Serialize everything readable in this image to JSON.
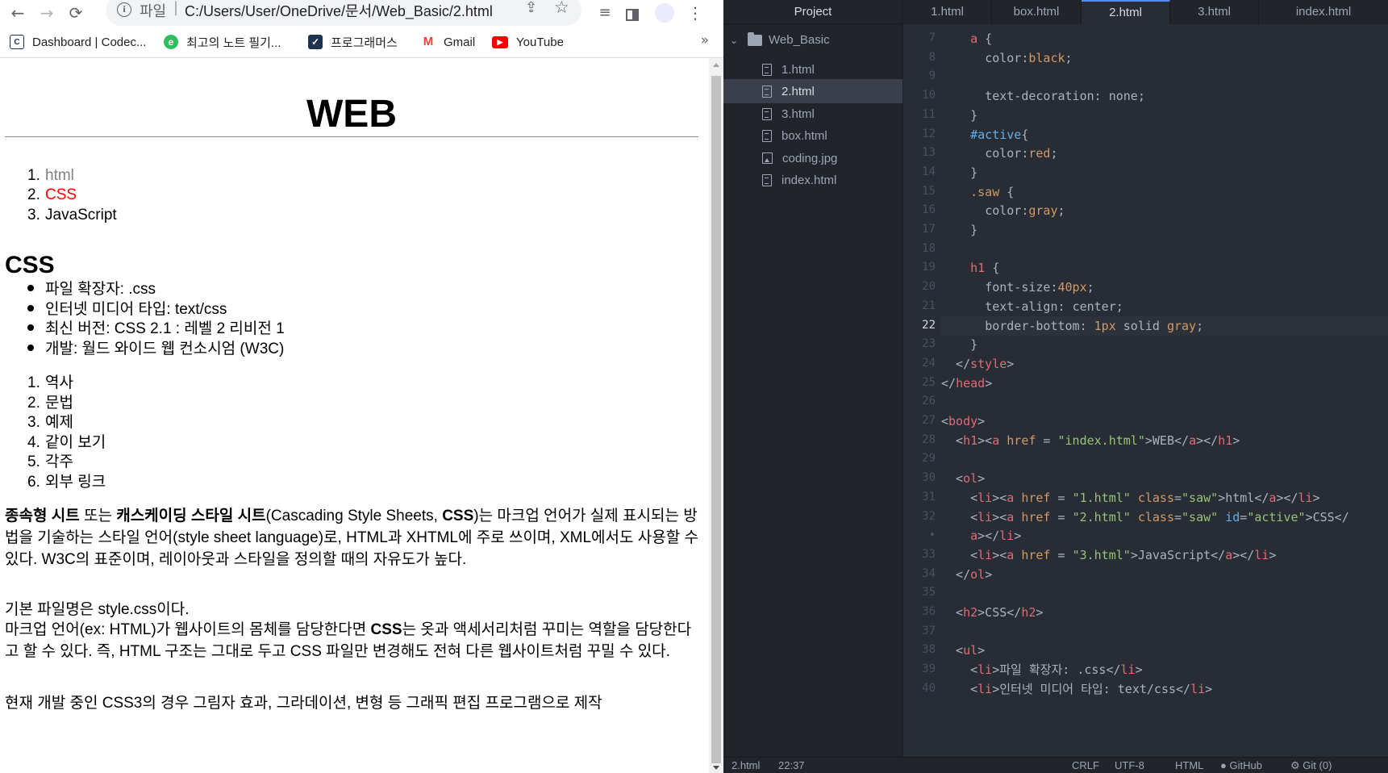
{
  "browser": {
    "nav": {
      "back": "←",
      "forward": "→",
      "reload": "⟳"
    },
    "omnibox": {
      "scheme": "파일",
      "separator": "|",
      "url": "C:/Users/User/OneDrive/문서/Web_Basic/2.html"
    },
    "bookmarks": [
      {
        "icon": "codecademy-icon",
        "label": "Dashboard | Codec...",
        "color": "#1f2d5c"
      },
      {
        "icon": "evernote-icon",
        "label": "최고의 노트 필기...",
        "color": "#2dbe60"
      },
      {
        "icon": "programmers-icon",
        "label": "프로그래머스",
        "color": "#1e3350"
      },
      {
        "icon": "gmail-icon",
        "label": "Gmail",
        "color": "#ea4335"
      },
      {
        "icon": "youtube-icon",
        "label": "YouTube",
        "color": "#ff0000"
      }
    ],
    "bookmarks_more": "»"
  },
  "page": {
    "h1": "WEB",
    "nav_list": [
      {
        "num": "1.",
        "label": "html",
        "color": "#808080"
      },
      {
        "num": "2.",
        "label": "CSS",
        "color": "#ff0000"
      },
      {
        "num": "3.",
        "label": "JavaScript",
        "color": "#000000"
      }
    ],
    "h2": "CSS",
    "facts": [
      "파일 확장자: .css",
      "인터넷 미디어 타입: text/css",
      "최신 버전: CSS 2.1 : 레벨 2 리비전 1",
      "개발: 월드 와이드 웹 컨소시엄 (W3C)"
    ],
    "sections": [
      {
        "num": "1.",
        "label": "역사"
      },
      {
        "num": "2.",
        "label": "문법"
      },
      {
        "num": "3.",
        "label": "예제"
      },
      {
        "num": "4.",
        "label": "같이 보기"
      },
      {
        "num": "5.",
        "label": "각주"
      },
      {
        "num": "6.",
        "label": "외부 링크"
      }
    ],
    "para1": {
      "b1": "종속형 시트",
      "t1": " 또는 ",
      "b2": "캐스케이딩 스타일 시트",
      "t2": "(Cascading Style Sheets, ",
      "b3": "CSS",
      "t3": ")는 마크업 언어가 실제 표시되는 방법을 기술하는 스타일 언어(style sheet language)로, HTML과 XHTML에 주로 쓰이며, XML에서도 사용할 수 있다. W3C의 표준이며, 레이아웃과 스타일을 정의할 때의 자유도가 높다."
    },
    "para2_line1": "기본 파일명은 style.css이다.",
    "para2": {
      "t1": "마크업 언어(ex: HTML)가 웹사이트의 몸체를 담당한다면 ",
      "b1": "CSS",
      "t2": "는 옷과 액세서리처럼 꾸미는 역할을 담당한다고 할 수 있다. 즉, HTML 구조는 그대로 두고 CSS 파일만 변경해도 전혀 다른 웹사이트처럼 꾸밀 수 있다."
    },
    "para3": "현재 개발 중인 CSS3의 경우 그림자 효과, 그라데이션, 변형 등 그래픽 편집 프로그램으로 제작"
  },
  "editor": {
    "tree_header": "Project",
    "root_folder": "Web_Basic",
    "files": [
      {
        "name": "1.html",
        "icon": "file-icon",
        "selected": false
      },
      {
        "name": "2.html",
        "icon": "file-icon",
        "selected": true
      },
      {
        "name": "3.html",
        "icon": "file-icon",
        "selected": false
      },
      {
        "name": "box.html",
        "icon": "file-icon",
        "selected": false
      },
      {
        "name": "coding.jpg",
        "icon": "image-file-icon",
        "selected": false
      },
      {
        "name": "index.html",
        "icon": "file-icon",
        "selected": false
      }
    ],
    "tabs": [
      {
        "label": "1.html",
        "active": false
      },
      {
        "label": "box.html",
        "active": false
      },
      {
        "label": "2.html",
        "active": true
      },
      {
        "label": "3.html",
        "active": false
      },
      {
        "label": "index.html",
        "active": false
      }
    ],
    "current_line": "22",
    "lines": [
      {
        "n": "7",
        "tokens": [
          [
            "t-pun",
            "    "
          ],
          [
            "t-sel",
            "a"
          ],
          [
            "t-pun",
            " {"
          ]
        ]
      },
      {
        "n": "8",
        "tokens": [
          [
            "t-pun",
            "      "
          ],
          [
            "t-prop",
            "color"
          ],
          [
            "t-pun",
            ":"
          ],
          [
            "t-val",
            "black"
          ],
          [
            "t-pun",
            ";"
          ]
        ]
      },
      {
        "n": "9",
        "tokens": [
          [
            "t-pun",
            ""
          ]
        ]
      },
      {
        "n": "10",
        "tokens": [
          [
            "t-pun",
            "      "
          ],
          [
            "t-prop",
            "text-decoration"
          ],
          [
            "t-pun",
            ": "
          ],
          [
            "t-prop",
            "none"
          ],
          [
            "t-pun",
            ";"
          ]
        ]
      },
      {
        "n": "11",
        "tokens": [
          [
            "t-pun",
            "    }"
          ]
        ]
      },
      {
        "n": "12",
        "tokens": [
          [
            "t-pun",
            "    "
          ],
          [
            "t-id",
            "#active"
          ],
          [
            "t-pun",
            "{"
          ]
        ]
      },
      {
        "n": "13",
        "tokens": [
          [
            "t-pun",
            "      "
          ],
          [
            "t-prop",
            "color"
          ],
          [
            "t-pun",
            ":"
          ],
          [
            "t-val",
            "red"
          ],
          [
            "t-pun",
            ";"
          ]
        ]
      },
      {
        "n": "14",
        "tokens": [
          [
            "t-pun",
            "    }"
          ]
        ]
      },
      {
        "n": "15",
        "tokens": [
          [
            "t-pun",
            "    "
          ],
          [
            "t-cls",
            ".saw"
          ],
          [
            "t-pun",
            " {"
          ]
        ]
      },
      {
        "n": "16",
        "tokens": [
          [
            "t-pun",
            "      "
          ],
          [
            "t-prop",
            "color"
          ],
          [
            "t-pun",
            ":"
          ],
          [
            "t-val",
            "gray"
          ],
          [
            "t-pun",
            ";"
          ]
        ]
      },
      {
        "n": "17",
        "tokens": [
          [
            "t-pun",
            "    }"
          ]
        ]
      },
      {
        "n": "18",
        "tokens": [
          [
            "t-pun",
            ""
          ]
        ]
      },
      {
        "n": "19",
        "tokens": [
          [
            "t-pun",
            "    "
          ],
          [
            "t-sel",
            "h1"
          ],
          [
            "t-pun",
            " {"
          ]
        ]
      },
      {
        "n": "20",
        "tokens": [
          [
            "t-pun",
            "      "
          ],
          [
            "t-prop",
            "font-size"
          ],
          [
            "t-pun",
            ":"
          ],
          [
            "t-num",
            "40px"
          ],
          [
            "t-pun",
            ";"
          ]
        ]
      },
      {
        "n": "21",
        "tokens": [
          [
            "t-pun",
            "      "
          ],
          [
            "t-prop",
            "text-align"
          ],
          [
            "t-pun",
            ": "
          ],
          [
            "t-prop",
            "center"
          ],
          [
            "t-pun",
            ";"
          ]
        ]
      },
      {
        "n": "22",
        "tokens": [
          [
            "t-pun",
            "      "
          ],
          [
            "t-prop",
            "border-bottom"
          ],
          [
            "t-pun",
            ": "
          ],
          [
            "t-num",
            "1px"
          ],
          [
            "t-prop",
            " solid "
          ],
          [
            "t-val",
            "gray"
          ],
          [
            "t-pun",
            ";"
          ]
        ]
      },
      {
        "n": "23",
        "tokens": [
          [
            "t-pun",
            "    }"
          ]
        ]
      },
      {
        "n": "24",
        "tokens": [
          [
            "t-pun",
            "  </"
          ],
          [
            "t-tag",
            "style"
          ],
          [
            "t-pun",
            ">"
          ]
        ]
      },
      {
        "n": "25",
        "tokens": [
          [
            "t-pun",
            "</"
          ],
          [
            "t-tag",
            "head"
          ],
          [
            "t-pun",
            ">"
          ]
        ]
      },
      {
        "n": "26",
        "tokens": [
          [
            "t-pun",
            ""
          ]
        ]
      },
      {
        "n": "27",
        "tokens": [
          [
            "t-pun",
            "<"
          ],
          [
            "t-tag",
            "body"
          ],
          [
            "t-pun",
            ">"
          ]
        ]
      },
      {
        "n": "28",
        "tokens": [
          [
            "t-pun",
            "  <"
          ],
          [
            "t-tag",
            "h1"
          ],
          [
            "t-pun",
            "><"
          ],
          [
            "t-tag",
            "a"
          ],
          [
            "t-attr",
            " href"
          ],
          [
            "t-pun",
            " = "
          ],
          [
            "t-str",
            "\"index.html\""
          ],
          [
            "t-pun",
            ">WEB</"
          ],
          [
            "t-tag",
            "a"
          ],
          [
            "t-pun",
            "></"
          ],
          [
            "t-tag",
            "h1"
          ],
          [
            "t-pun",
            ">"
          ]
        ]
      },
      {
        "n": "29",
        "tokens": [
          [
            "t-pun",
            ""
          ]
        ]
      },
      {
        "n": "30",
        "tokens": [
          [
            "t-pun",
            "  <"
          ],
          [
            "t-tag",
            "ol"
          ],
          [
            "t-pun",
            ">"
          ]
        ]
      },
      {
        "n": "31",
        "tokens": [
          [
            "t-pun",
            "    <"
          ],
          [
            "t-tag",
            "li"
          ],
          [
            "t-pun",
            "><"
          ],
          [
            "t-tag",
            "a"
          ],
          [
            "t-attr",
            " href"
          ],
          [
            "t-pun",
            " = "
          ],
          [
            "t-str",
            "\"1.html\""
          ],
          [
            "t-attr",
            " class"
          ],
          [
            "t-pun",
            "="
          ],
          [
            "t-str",
            "\"saw\""
          ],
          [
            "t-pun",
            ">html</"
          ],
          [
            "t-tag",
            "a"
          ],
          [
            "t-pun",
            "></"
          ],
          [
            "t-tag",
            "li"
          ],
          [
            "t-pun",
            ">"
          ]
        ]
      },
      {
        "n": "32",
        "tokens": [
          [
            "t-pun",
            "    <"
          ],
          [
            "t-tag",
            "li"
          ],
          [
            "t-pun",
            "><"
          ],
          [
            "t-tag",
            "a"
          ],
          [
            "t-attr",
            " href"
          ],
          [
            "t-pun",
            " = "
          ],
          [
            "t-str",
            "\"2.html\""
          ],
          [
            "t-attr",
            " class"
          ],
          [
            "t-pun",
            "="
          ],
          [
            "t-str",
            "\"saw\""
          ],
          [
            "t-id",
            " id"
          ],
          [
            "t-pun",
            "="
          ],
          [
            "t-str",
            "\"active\""
          ],
          [
            "t-pun",
            ">CSS</"
          ]
        ]
      },
      {
        "n": "•",
        "tokens": [
          [
            "t-pun",
            "    "
          ],
          [
            "t-tag",
            "a"
          ],
          [
            "t-pun",
            "></"
          ],
          [
            "t-tag",
            "li"
          ],
          [
            "t-pun",
            ">"
          ]
        ]
      },
      {
        "n": "33",
        "tokens": [
          [
            "t-pun",
            "    <"
          ],
          [
            "t-tag",
            "li"
          ],
          [
            "t-pun",
            "><"
          ],
          [
            "t-tag",
            "a"
          ],
          [
            "t-attr",
            " href"
          ],
          [
            "t-pun",
            " = "
          ],
          [
            "t-str",
            "\"3.html\""
          ],
          [
            "t-pun",
            ">JavaScript</"
          ],
          [
            "t-tag",
            "a"
          ],
          [
            "t-pun",
            "></"
          ],
          [
            "t-tag",
            "li"
          ],
          [
            "t-pun",
            ">"
          ]
        ]
      },
      {
        "n": "34",
        "tokens": [
          [
            "t-pun",
            "  </"
          ],
          [
            "t-tag",
            "ol"
          ],
          [
            "t-pun",
            ">"
          ]
        ]
      },
      {
        "n": "35",
        "tokens": [
          [
            "t-pun",
            ""
          ]
        ]
      },
      {
        "n": "36",
        "tokens": [
          [
            "t-pun",
            "  <"
          ],
          [
            "t-tag",
            "h2"
          ],
          [
            "t-pun",
            ">CSS</"
          ],
          [
            "t-tag",
            "h2"
          ],
          [
            "t-pun",
            ">"
          ]
        ]
      },
      {
        "n": "37",
        "tokens": [
          [
            "t-pun",
            ""
          ]
        ]
      },
      {
        "n": "38",
        "tokens": [
          [
            "t-pun",
            "  <"
          ],
          [
            "t-tag",
            "ul"
          ],
          [
            "t-pun",
            ">"
          ]
        ]
      },
      {
        "n": "39",
        "tokens": [
          [
            "t-pun",
            "    <"
          ],
          [
            "t-tag",
            "li"
          ],
          [
            "t-pun",
            ">파일 확장자: .css</"
          ],
          [
            "t-tag",
            "li"
          ],
          [
            "t-pun",
            ">"
          ]
        ]
      },
      {
        "n": "40",
        "tokens": [
          [
            "t-pun",
            "    <"
          ],
          [
            "t-tag",
            "li"
          ],
          [
            "t-pun",
            ">인터넷 미디어 타입: text/css</"
          ],
          [
            "t-tag",
            "li"
          ],
          [
            "t-pun",
            ">"
          ]
        ]
      }
    ],
    "status": {
      "file": "2.html",
      "cursor": "22:37",
      "eol": "CRLF",
      "encoding": "UTF-8",
      "grammar": "HTML",
      "github": "GitHub",
      "git": "Git (0)"
    }
  }
}
